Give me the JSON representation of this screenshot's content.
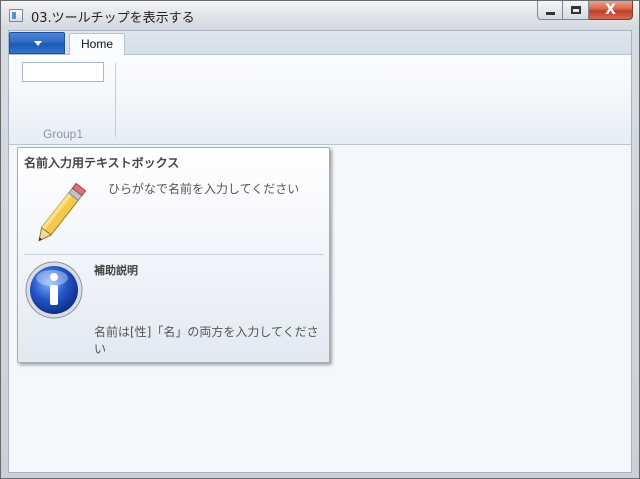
{
  "window": {
    "title": "03.ツールチップを表示する",
    "close_glyph": "X"
  },
  "ribbon": {
    "tabs": [
      {
        "label": "Home",
        "selected": true
      }
    ],
    "groups": [
      {
        "label": "Group1",
        "textbox_value": ""
      }
    ]
  },
  "tooltip": {
    "title": "名前入力用テキストボックス",
    "description": "ひらがなで名前を入力してください",
    "footer_title": "補助説明",
    "footer_text": "名前は[性]「名」の両方を入力してください",
    "main_icon": "pencil-icon",
    "footer_icon": "info-icon"
  },
  "colors": {
    "app_menu_blue": "#2f6cc8",
    "close_red": "#c0402a",
    "ribbon_bg": "#f1f5fa"
  }
}
